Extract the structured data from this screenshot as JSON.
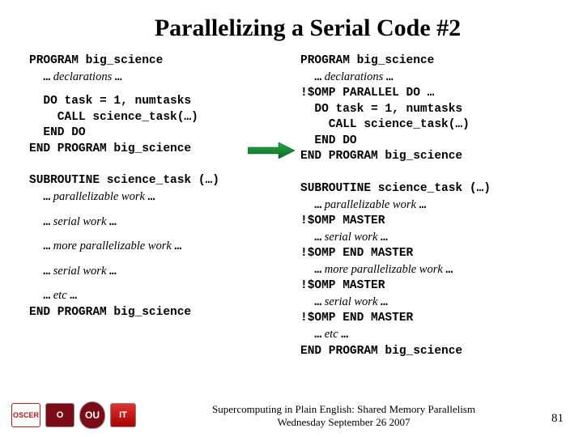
{
  "title": "Parallelizing a Serial Code #2",
  "left": {
    "p1_l1": "PROGRAM big_science",
    "p1_l2a": "  …",
    "p1_l2b": " declarations ",
    "p1_l2c": "…",
    "p1_l3": "  DO task = 1, numtasks",
    "p1_l4": "    CALL science_task(…)",
    "p1_l5": "  END DO",
    "p1_l6": "END PROGRAM big_science",
    "s1_l1": "SUBROUTINE science_task (…)",
    "s1_l2a": "  …",
    "s1_l2b": " parallelizable work ",
    "s1_l2c": "…",
    "s1_l3a": "  …",
    "s1_l3b": " serial work ",
    "s1_l3c": "…",
    "s1_l4a": "  …",
    "s1_l4b": " more parallelizable work ",
    "s1_l4c": "…",
    "s1_l5a": "  …",
    "s1_l5b": " serial work ",
    "s1_l5c": "…",
    "s1_l6a": "  …",
    "s1_l6b": " etc ",
    "s1_l6c": "…",
    "s1_l7": "END PROGRAM big_science"
  },
  "right": {
    "p2_l1": "PROGRAM big_science",
    "p2_l2a": "  …",
    "p2_l2b": " declarations ",
    "p2_l2c": "…",
    "p2_l3": "!$OMP PARALLEL DO …",
    "p2_l4": "  DO task = 1, numtasks",
    "p2_l5": "    CALL science_task(…)",
    "p2_l6": "  END DO",
    "p2_l7": "END PROGRAM big_science",
    "s2_l1": "SUBROUTINE science_task (…)",
    "s2_l2a": "  …",
    "s2_l2b": " parallelizable work ",
    "s2_l2c": "…",
    "s2_l3": "!$OMP MASTER",
    "s2_l4a": "  …",
    "s2_l4b": " serial work ",
    "s2_l4c": "…",
    "s2_l5": "!$OMP END MASTER",
    "s2_l6a": "  …",
    "s2_l6b": " more parallelizable work ",
    "s2_l6c": "…",
    "s2_l7": "!$OMP MASTER",
    "s2_l8a": "  …",
    "s2_l8b": " serial work ",
    "s2_l8c": "…",
    "s2_l9": "!$OMP END MASTER",
    "s2_l10a": "  …",
    "s2_l10b": " etc ",
    "s2_l10c": "…",
    "s2_l11": "END PROGRAM big_science"
  },
  "footer": {
    "line1": "Supercomputing in Plain English: Shared Memory Parallelism",
    "line2": "Wednesday September 26 2007"
  },
  "page": "81",
  "logos": {
    "a": "OSCER",
    "b": "O",
    "c": "OU",
    "d": "IT"
  }
}
